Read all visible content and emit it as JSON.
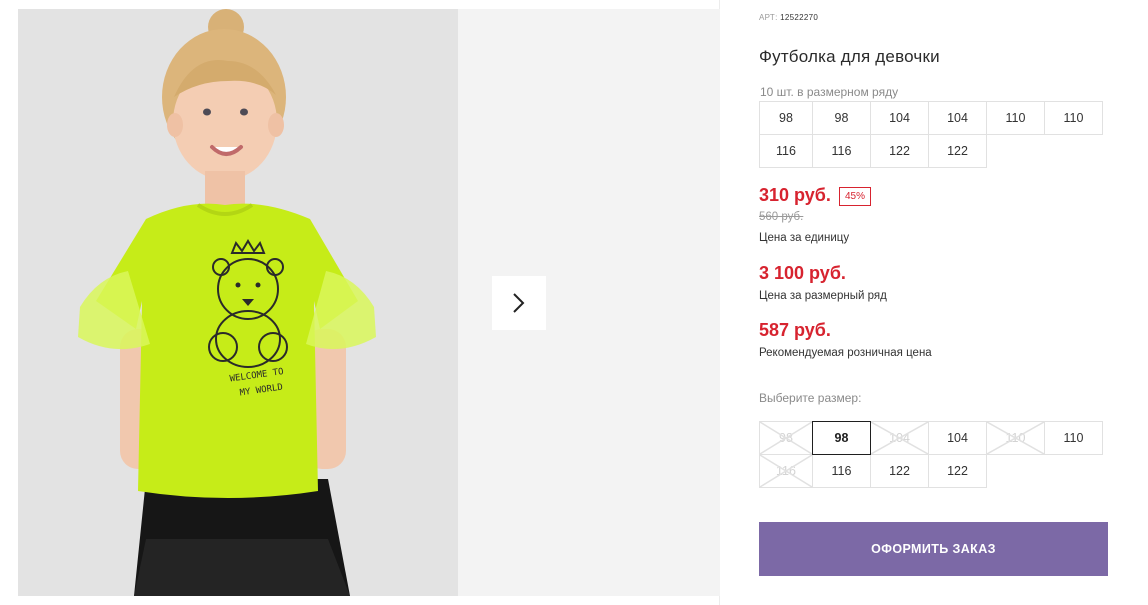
{
  "gallery": {
    "photo_caption_line1": "WELCOME TO",
    "photo_caption_line2": "MY WORLD",
    "next_icon": "chevron-right-icon"
  },
  "product": {
    "art_prefix": "АРТ:",
    "art_number": "12522270",
    "title": "Футболка для девочки",
    "row_note": "10 шт. в размерном ряду",
    "size_row": [
      "98",
      "98",
      "104",
      "104",
      "110",
      "110",
      "116",
      "116",
      "122",
      "122"
    ],
    "unit_price": "310 руб.",
    "discount": "45%",
    "old_price": "560 руб.",
    "unit_price_label": "Цена за единицу",
    "row_price": "3 100 руб.",
    "row_price_label": "Цена за размерный ряд",
    "retail_price": "587 руб.",
    "retail_price_label": "Рекомендуемая розничная цена",
    "choose_label": "Выберите размер:",
    "choose_sizes": [
      {
        "label": "98",
        "state": "disabled"
      },
      {
        "label": "98",
        "state": "selected"
      },
      {
        "label": "104",
        "state": "disabled"
      },
      {
        "label": "104",
        "state": "available"
      },
      {
        "label": "110",
        "state": "disabled"
      },
      {
        "label": "110",
        "state": "available"
      },
      {
        "label": "116",
        "state": "disabled"
      },
      {
        "label": "116",
        "state": "available"
      },
      {
        "label": "122",
        "state": "available"
      },
      {
        "label": "122",
        "state": "available"
      }
    ],
    "order_button": "ОФОРМИТЬ ЗАКАЗ"
  },
  "colors": {
    "accent_price": "#d7232f",
    "order_button_bg": "#7c69a6",
    "shirt": "#c6ec18",
    "skirt": "#161616",
    "photo_bg": "#e3e3e3"
  }
}
